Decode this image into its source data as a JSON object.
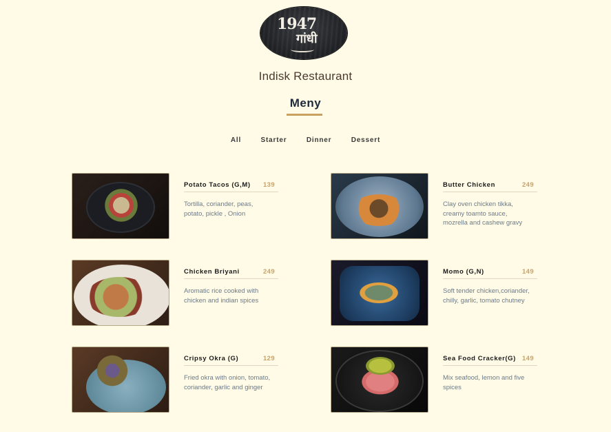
{
  "header": {
    "logo_number": "1947",
    "logo_script": "गांधी",
    "restaurant_name": "Indisk Restaurant",
    "section_title": "Meny"
  },
  "filters": [
    "All",
    "Starter",
    "Dinner",
    "Dessert"
  ],
  "items": [
    {
      "name": "Potato Tacos (G,M)",
      "price": "139",
      "desc": "Tortilla, coriander, peas, potato, pickle , Onion"
    },
    {
      "name": "Butter Chicken",
      "price": "249",
      "desc": "Clay oven chicken tikka, creamy toamto sauce, mozrella and cashew gravy"
    },
    {
      "name": "Chicken Briyani",
      "price": "249",
      "desc": "Aromatic rice cooked with chicken and indian spices"
    },
    {
      "name": "Momo (G,N)",
      "price": "149",
      "desc": "Soft tender chicken,coriander, chilly, garlic, tomato chutney"
    },
    {
      "name": "Cripsy Okra (G)",
      "price": "129",
      "desc": "Fried okra with onion, tomato, coriander, garlic and ginger"
    },
    {
      "name": "Sea Food Cracker(G)",
      "price": "149",
      "desc": "Mix seafood, lemon and five spices"
    }
  ],
  "colors": {
    "background": "#fffbe6",
    "accent": "#c8a060",
    "price": "#c9a26a",
    "description": "#6c7a88"
  }
}
